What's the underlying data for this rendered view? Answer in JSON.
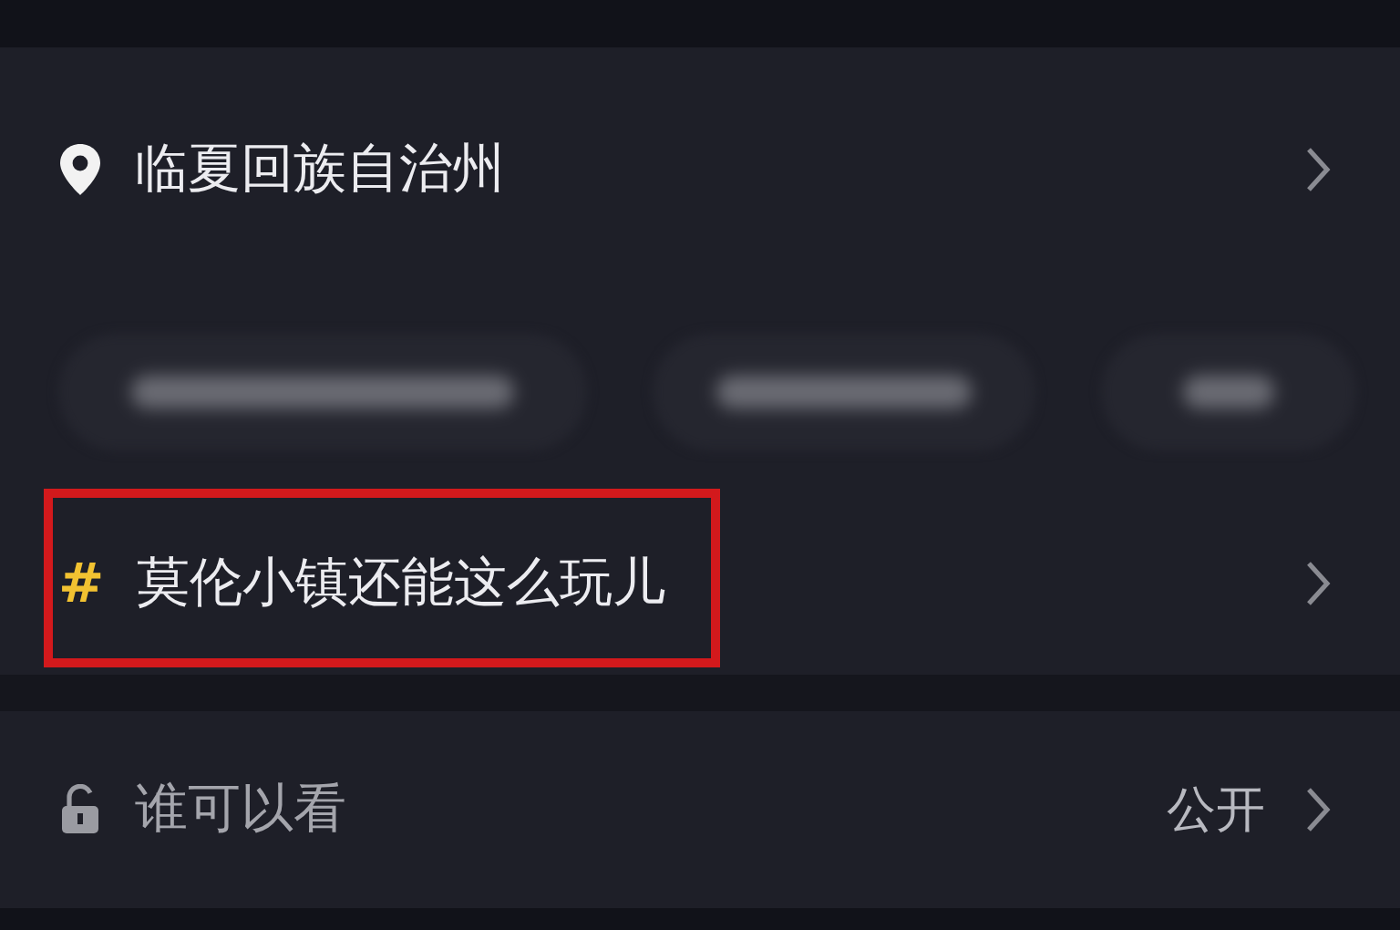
{
  "location_row": {
    "label": "临夏回族自治州"
  },
  "suggestion_chips": [
    {
      "kind": "blurred"
    },
    {
      "kind": "blurred"
    },
    {
      "kind": "blurred"
    }
  ],
  "topic_row": {
    "symbol": "#",
    "label": "莫伦小镇还能这么玩儿",
    "highlighted": true
  },
  "visibility_row": {
    "label": "谁可以看",
    "value": "公开"
  }
}
